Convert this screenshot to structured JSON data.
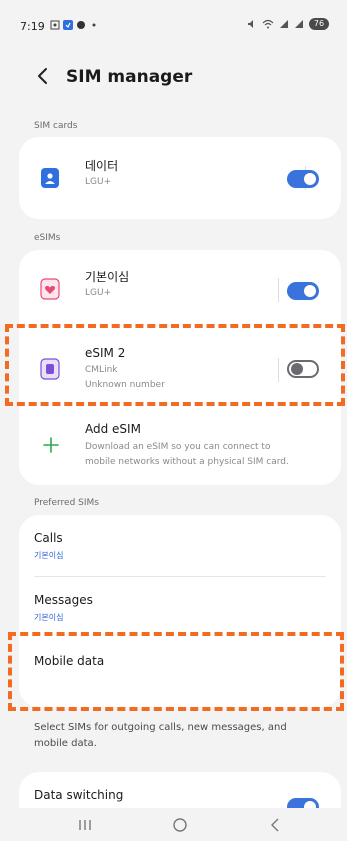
{
  "status": {
    "time": "7:19",
    "battery": "76"
  },
  "appbar": {
    "title": "SIM manager"
  },
  "sections": {
    "sim_cards": "SIM cards",
    "esims": "eSIMs",
    "preferred": "Preferred SIMs"
  },
  "sim_cards": [
    {
      "name": "데이터",
      "carrier": "LGU+",
      "enabled": true
    }
  ],
  "esims": [
    {
      "name": "기본이심",
      "carrier": "LGU+",
      "enabled": true
    },
    {
      "name": "eSIM 2",
      "carrier": "CMLink",
      "number": "Unknown number",
      "enabled": false
    }
  ],
  "add_esim": {
    "title": "Add eSIM",
    "description_line1": "Download an eSIM so you can connect to",
    "description_line2": "mobile networks without a physical SIM card."
  },
  "preferred": {
    "calls": {
      "label": "Calls",
      "value": "기본이심"
    },
    "messages": {
      "label": "Messages",
      "value": "기본이심"
    },
    "mobile_data": {
      "label": "Mobile data"
    }
  },
  "footnote": {
    "line1": "Select SIMs for outgoing calls, new messages, and",
    "line2": "mobile data."
  },
  "data_switching": {
    "label": "Data switching",
    "enabled": true
  },
  "colors": {
    "accent": "#3a73dc",
    "annotation": "#f26b21",
    "background": "#f3f3f4"
  }
}
